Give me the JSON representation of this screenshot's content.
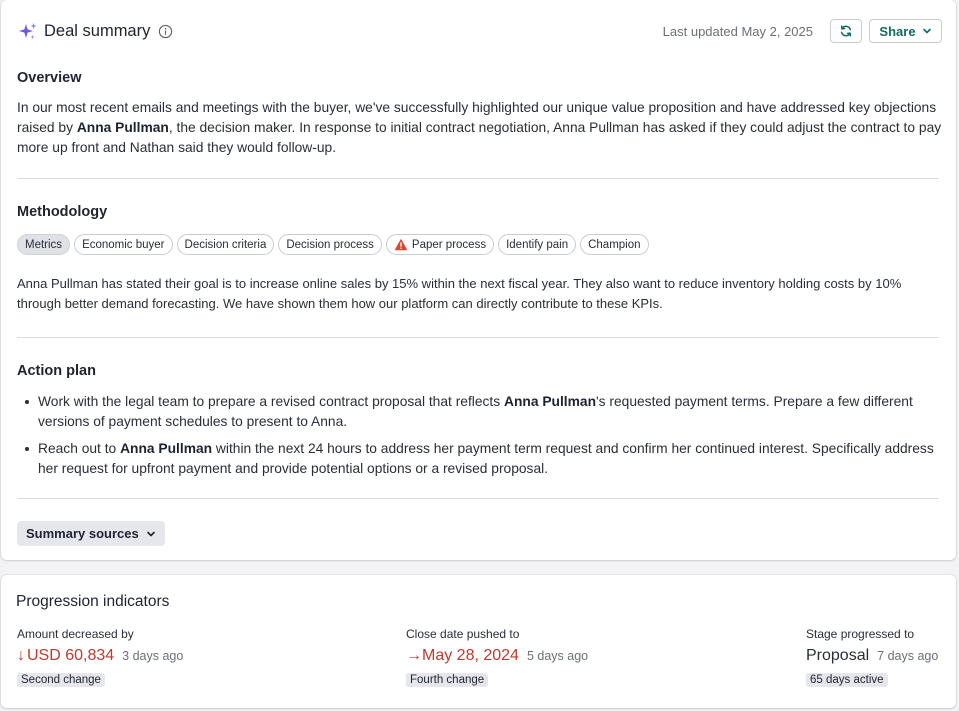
{
  "header": {
    "title": "Deal summary",
    "last_updated": "Last updated May 2, 2025",
    "share_label": "Share",
    "icons": [
      "sparkle-icon",
      "info-icon",
      "refresh-icon",
      "chevron-down-icon"
    ],
    "accent_color": "#126b5f"
  },
  "overview": {
    "title": "Overview",
    "t1": "In our most recent emails and meetings with the buyer, we've successfully highlighted our unique value proposition and have addressed key objections raised by ",
    "name": "Anna Pullman",
    "t2": ", the decision maker. In response to initial contract negotiation, Anna Pullman has asked if they could adjust the contract to pay more up front and Nathan said they would follow-up."
  },
  "methodology": {
    "title": "Methodology",
    "chips": [
      "Metrics",
      "Economic buyer",
      "Decision criteria",
      "Decision process",
      "Paper process",
      "Identify pain",
      "Champion"
    ],
    "active_chip": "Metrics",
    "warning_chip": "Paper process",
    "text": "Anna Pullman has stated their goal is to increase online sales by 15% within the next fiscal year. They also want to reduce inventory holding costs by 10% through better demand forecasting. We have shown them how our platform can directly contribute to these KPIs."
  },
  "action_plan": {
    "title": "Action plan",
    "item1_a": "Work with the legal team to prepare a revised contract proposal that reflects ",
    "item1_name": "Anna Pullman",
    "item1_b": "'s requested payment terms. Prepare a few different versions of payment schedules to present to Anna.",
    "item2_a": "Reach out to ",
    "item2_name": "Anna Pullman",
    "item2_b": " within the next 24 hours to address her payment term request and confirm her continued interest. Specifically address her request for upfront payment and provide potential options or a revised proposal."
  },
  "summary_sources_label": "Summary sources",
  "progression": {
    "title": "Progression indicators",
    "amount": {
      "label": "Amount decreased by",
      "arrow": "↓",
      "value": "USD 60,834",
      "ago": "3 days ago",
      "tag": "Second change"
    },
    "close": {
      "label": "Close date pushed to",
      "arrow": "→",
      "value": "May 28, 2024",
      "ago": "5 days ago",
      "tag": "Fourth change"
    },
    "stage": {
      "label": "Stage progressed to",
      "value": "Proposal",
      "ago": "7 days ago",
      "tag": "65 days active"
    },
    "negative_color": "#c0392b"
  }
}
